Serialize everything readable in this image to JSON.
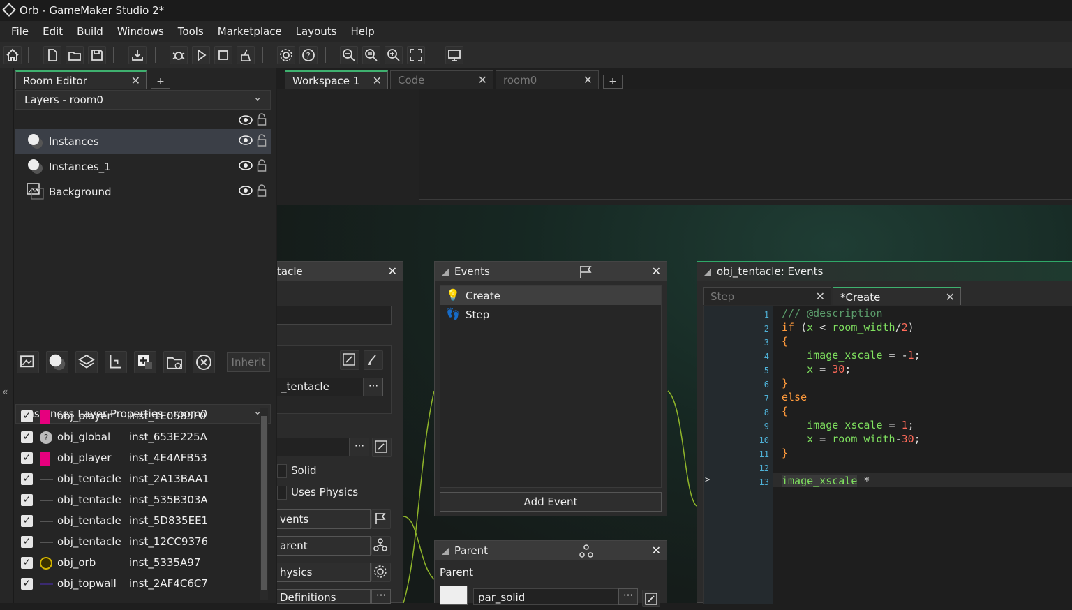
{
  "window": {
    "title": "Orb - GameMaker Studio 2*"
  },
  "menu": [
    "File",
    "Edit",
    "Build",
    "Windows",
    "Tools",
    "Marketplace",
    "Layouts",
    "Help"
  ],
  "left_panel": {
    "tab_label": "Room Editor",
    "layers_header": "Layers - room0",
    "layers": [
      {
        "name": "Instances",
        "selected": true
      },
      {
        "name": "Instances_1",
        "selected": false
      },
      {
        "name": "Background",
        "selected": false
      }
    ],
    "inherit_label": "Inherit",
    "props_header": "Instances Layer Properties - room0",
    "instances": [
      {
        "object": "obj_player",
        "id": "inst_1E0585F0",
        "color": "#e6007e"
      },
      {
        "object": "obj_global",
        "id": "inst_653E225A",
        "color": "#888888"
      },
      {
        "object": "obj_player",
        "id": "inst_4E4AFB53",
        "color": "#e6007e"
      },
      {
        "object": "obj_tentacle",
        "id": "inst_2A13BAA1",
        "color": "#444444"
      },
      {
        "object": "obj_tentacle",
        "id": "inst_535B303A",
        "color": "#444444"
      },
      {
        "object": "obj_tentacle",
        "id": "inst_5D835EE1",
        "color": "#444444"
      },
      {
        "object": "obj_tentacle",
        "id": "inst_12CC9376",
        "color": "#444444"
      },
      {
        "object": "obj_orb",
        "id": "inst_5335A97",
        "color": "#d4b400"
      },
      {
        "object": "obj_topwall",
        "id": "inst_2AF4C6C7",
        "color": "#3a2a70"
      }
    ]
  },
  "workspace_tabs": [
    {
      "label": "Workspace 1",
      "active": true
    },
    {
      "label": "Code",
      "active": false
    },
    {
      "label": "room0",
      "active": false
    }
  ],
  "object_window": {
    "title_fragment": "tacle",
    "name_fragment": "_tentacle",
    "solid_label": "Solid",
    "physics_label": "Uses Physics",
    "buttons": [
      "vents",
      "arent",
      "hysics",
      "Definitions"
    ]
  },
  "events_window": {
    "title": "Events",
    "events": [
      {
        "name": "Create",
        "selected": true
      },
      {
        "name": "Step",
        "selected": false
      }
    ],
    "add_label": "Add Event"
  },
  "parent_window": {
    "title": "Parent",
    "label": "Parent",
    "value": "par_solid"
  },
  "code_window": {
    "title": "obj_tentacle: Events",
    "tabs": [
      {
        "label": "Step",
        "active": false
      },
      {
        "label": "*Create",
        "active": true
      }
    ],
    "line_numbers": [
      "1",
      "2",
      "3",
      "4",
      "5",
      "6",
      "7",
      "8",
      "9",
      "10",
      "11",
      "12",
      "13"
    ]
  }
}
